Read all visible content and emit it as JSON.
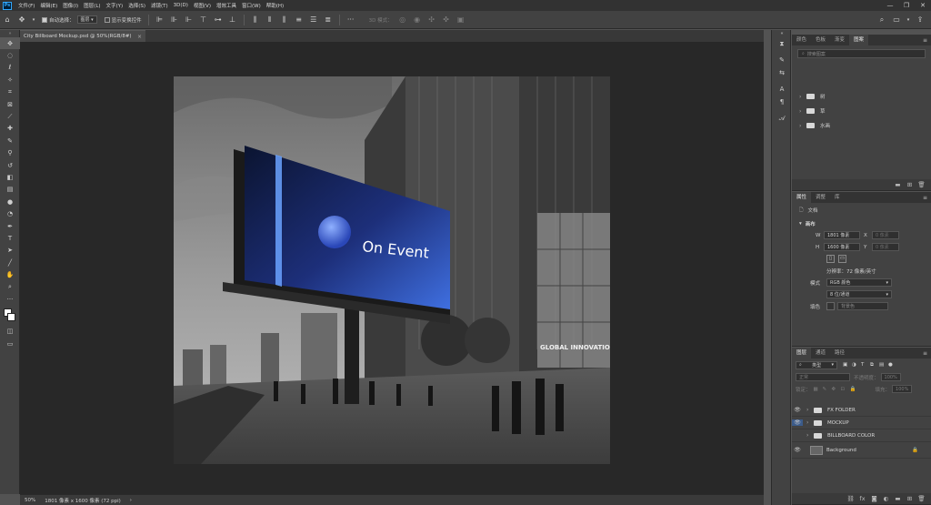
{
  "app": {
    "logo": "Ps",
    "menu": [
      "文件(F)",
      "编辑(E)",
      "图像(I)",
      "图层(L)",
      "文字(Y)",
      "选择(S)",
      "滤镜(T)",
      "3D(D)",
      "视图(V)",
      "增效工具",
      "窗口(W)",
      "帮助(H)"
    ],
    "window_controls": [
      "—",
      "❐",
      "✕"
    ]
  },
  "options": {
    "auto_select_label": "自动选择：",
    "auto_select_target": "图层",
    "show_transform_label": "显示变换控件",
    "mode_3d_label": "3D 模式："
  },
  "document": {
    "tab_label": "City Billboard Mockup.psd @ 50%(RGB/8#)",
    "tab_close": "×",
    "zoom": "50%",
    "doc_info": "1801 像素 x 1600 像素 (72 ppi)",
    "status_arrow": "›"
  },
  "artwork": {
    "billboard_title": "On Event",
    "building_sign": "GLOBAL INNOVATIONS"
  },
  "libraries_panel": {
    "tabs": [
      "颜色",
      "色板",
      "渐变",
      "图案"
    ],
    "active_tab": 3,
    "search_placeholder": "搜索图案",
    "groups": [
      "树",
      "草",
      "水画"
    ]
  },
  "properties_panel": {
    "tabs": [
      "属性",
      "调整",
      "库"
    ],
    "doc_label": "文档",
    "canvas_label": "画布",
    "width_label": "W",
    "width_value": "1801 像素",
    "height_label": "H",
    "height_value": "1600 像素",
    "x_label": "X",
    "y_label": "Y",
    "x_placeholder": "0 像素",
    "y_placeholder": "0 像素",
    "resolution": "分辨率：72 像素/英寸",
    "mode_label": "模式",
    "mode_value": "RGB 颜色",
    "depth_value": "8 位/通道",
    "fill_label": "填色",
    "fill_value": "背景色"
  },
  "layers_panel": {
    "tabs": [
      "图层",
      "通道",
      "路径"
    ],
    "filter_type": "类型",
    "blend_mode": "正常",
    "opacity_label": "不透明度：",
    "opacity_value": "100%",
    "lock_label": "锁定：",
    "fill_label": "填充：",
    "fill_value": "100%",
    "layers": [
      {
        "name": "FX FOLDER",
        "visible": true,
        "kind": "folder"
      },
      {
        "name": "MOCKUP",
        "visible": true,
        "kind": "folder",
        "selected_eye": true
      },
      {
        "name": "BILLBOARD COLOR",
        "visible": false,
        "kind": "folder"
      },
      {
        "name": "Background",
        "visible": true,
        "kind": "image",
        "locked": true
      }
    ]
  },
  "colors": {
    "accent_blue": "#3a6fd8",
    "menubar": "#323232",
    "panel": "#424242"
  }
}
